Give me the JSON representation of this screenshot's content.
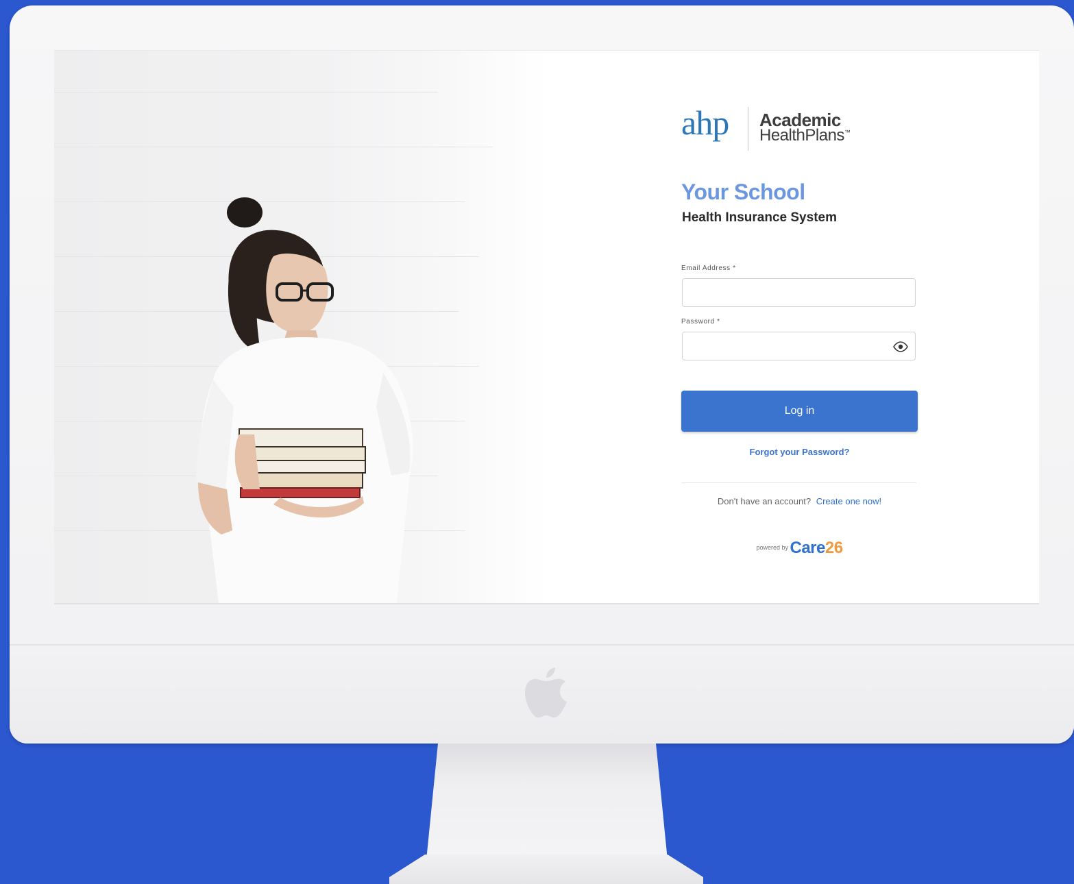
{
  "brand": {
    "logo_mark": "ahp",
    "name_line1": "Academic",
    "name_line2": "HealthPlans",
    "trademark": "™"
  },
  "login": {
    "title": "Your School",
    "subtitle": "Health Insurance System",
    "email_label": "Email Address *",
    "email_value": "",
    "password_label": "Password *",
    "password_value": "",
    "submit_label": "Log in",
    "forgot_label": "Forgot your Password?",
    "signup_prompt": "Don't have an account?",
    "signup_link": "Create one now!"
  },
  "footer": {
    "powered_by": "powered by",
    "care_brand": "Care",
    "care_number": "26"
  },
  "icons": {
    "password_toggle": "eye-icon",
    "device_logo": "apple-logo-icon"
  },
  "colors": {
    "background": "#2b57cf",
    "primary_button": "#3b74cf",
    "title": "#6a97df",
    "brand_logo": "#2b77b8",
    "care_accent": "#f09a3e"
  }
}
